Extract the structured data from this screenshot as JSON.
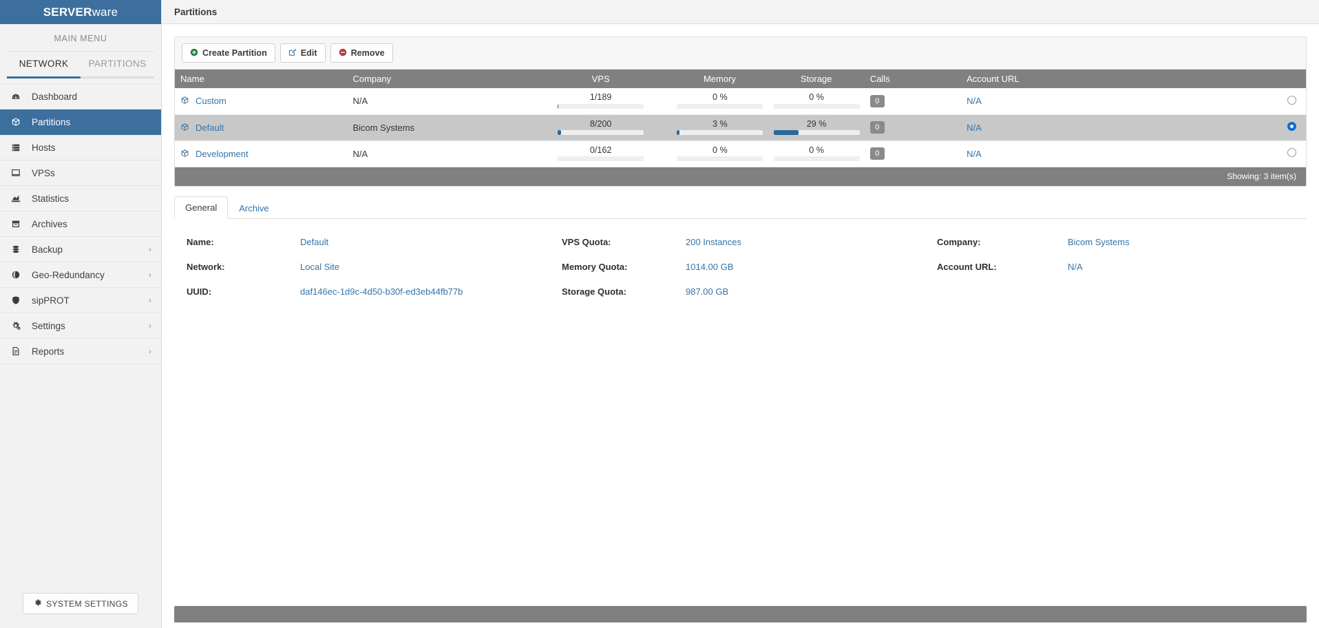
{
  "brand": {
    "strong": "SERVER",
    "light": "ware"
  },
  "sidebar": {
    "main_menu_label": "MAIN MENU",
    "segments": [
      {
        "label": "NETWORK",
        "active": true
      },
      {
        "label": "PARTITIONS",
        "active": false
      }
    ],
    "items": [
      {
        "label": "Dashboard",
        "icon": "dashboard-icon",
        "chevron": "",
        "active": false
      },
      {
        "label": "Partitions",
        "icon": "cube-icon",
        "chevron": "",
        "active": true
      },
      {
        "label": "Hosts",
        "icon": "server-rack-icon",
        "chevron": "",
        "active": false
      },
      {
        "label": "VPSs",
        "icon": "monitor-icon",
        "chevron": "",
        "active": false
      },
      {
        "label": "Statistics",
        "icon": "chart-icon",
        "chevron": "",
        "active": false
      },
      {
        "label": "Archives",
        "icon": "archive-box-icon",
        "chevron": "",
        "active": false
      },
      {
        "label": "Backup",
        "icon": "database-icon",
        "chevron": "›",
        "active": false
      },
      {
        "label": "Geo-Redundancy",
        "icon": "globe-icon",
        "chevron": "›",
        "active": false
      },
      {
        "label": "sipPROT",
        "icon": "shield-icon",
        "chevron": "›",
        "active": false
      },
      {
        "label": "Settings",
        "icon": "gears-icon",
        "chevron": "›",
        "active": false
      },
      {
        "label": "Reports",
        "icon": "document-icon",
        "chevron": "›",
        "active": false
      }
    ],
    "system_settings_label": "SYSTEM SETTINGS"
  },
  "header": {
    "title": "Partitions"
  },
  "toolbar": {
    "create_label": "Create Partition",
    "edit_label": "Edit",
    "remove_label": "Remove"
  },
  "table": {
    "columns": [
      "Name",
      "Company",
      "VPS",
      "Memory",
      "Storage",
      "Calls",
      "Account URL",
      ""
    ],
    "rows": [
      {
        "name": "Custom",
        "company": "N/A",
        "vps": {
          "text": "1/189",
          "percent": 1
        },
        "memory": {
          "text": "0 %",
          "percent": 0
        },
        "storage": {
          "text": "0 %",
          "percent": 0
        },
        "calls": "0",
        "account_url": "N/A",
        "selected": false
      },
      {
        "name": "Default",
        "company": "Bicom Systems",
        "vps": {
          "text": "8/200",
          "percent": 4
        },
        "memory": {
          "text": "3 %",
          "percent": 3
        },
        "storage": {
          "text": "29 %",
          "percent": 29
        },
        "calls": "0",
        "account_url": "N/A",
        "selected": true
      },
      {
        "name": "Development",
        "company": "N/A",
        "vps": {
          "text": "0/162",
          "percent": 0
        },
        "memory": {
          "text": "0 %",
          "percent": 0
        },
        "storage": {
          "text": "0 %",
          "percent": 0
        },
        "calls": "0",
        "account_url": "N/A",
        "selected": false
      }
    ],
    "footer": "Showing: 3 item(s)"
  },
  "details": {
    "tabs": [
      {
        "label": "General",
        "active": true
      },
      {
        "label": "Archive",
        "active": false
      }
    ],
    "col1": [
      {
        "label": "Name:",
        "value": "Default"
      },
      {
        "label": "Network:",
        "value": "Local Site"
      },
      {
        "label": "UUID:",
        "value": "daf146ec-1d9c-4d50-b30f-ed3eb44fb77b"
      }
    ],
    "col2": [
      {
        "label": "VPS Quota:",
        "value": "200 Instances"
      },
      {
        "label": "Memory Quota:",
        "value": "1014.00 GB"
      },
      {
        "label": "Storage Quota:",
        "value": "987.00 GB"
      }
    ],
    "col3": [
      {
        "label": "Company:",
        "value": "Bicom Systems"
      },
      {
        "label": "Account URL:",
        "value": "N/A"
      }
    ]
  },
  "icons": {
    "plus": "⊕",
    "edit": "✎",
    "remove": "⊖",
    "gear": "⚙",
    "cube": "⬡",
    "dashboard": "◔",
    "server-rack": "☰",
    "monitor": "▭",
    "chart": "◥",
    "archive": "▤",
    "database": "≡",
    "globe": "●",
    "shield": "❖",
    "gears": "⚙",
    "document": "▧"
  },
  "colors": {
    "brand": "#3c6f9e",
    "link": "#3573a8",
    "header_gray": "#808080",
    "selected_row": "#c8c8c8",
    "meter": "#2c6896",
    "radio_on": "#0a6ed1"
  }
}
